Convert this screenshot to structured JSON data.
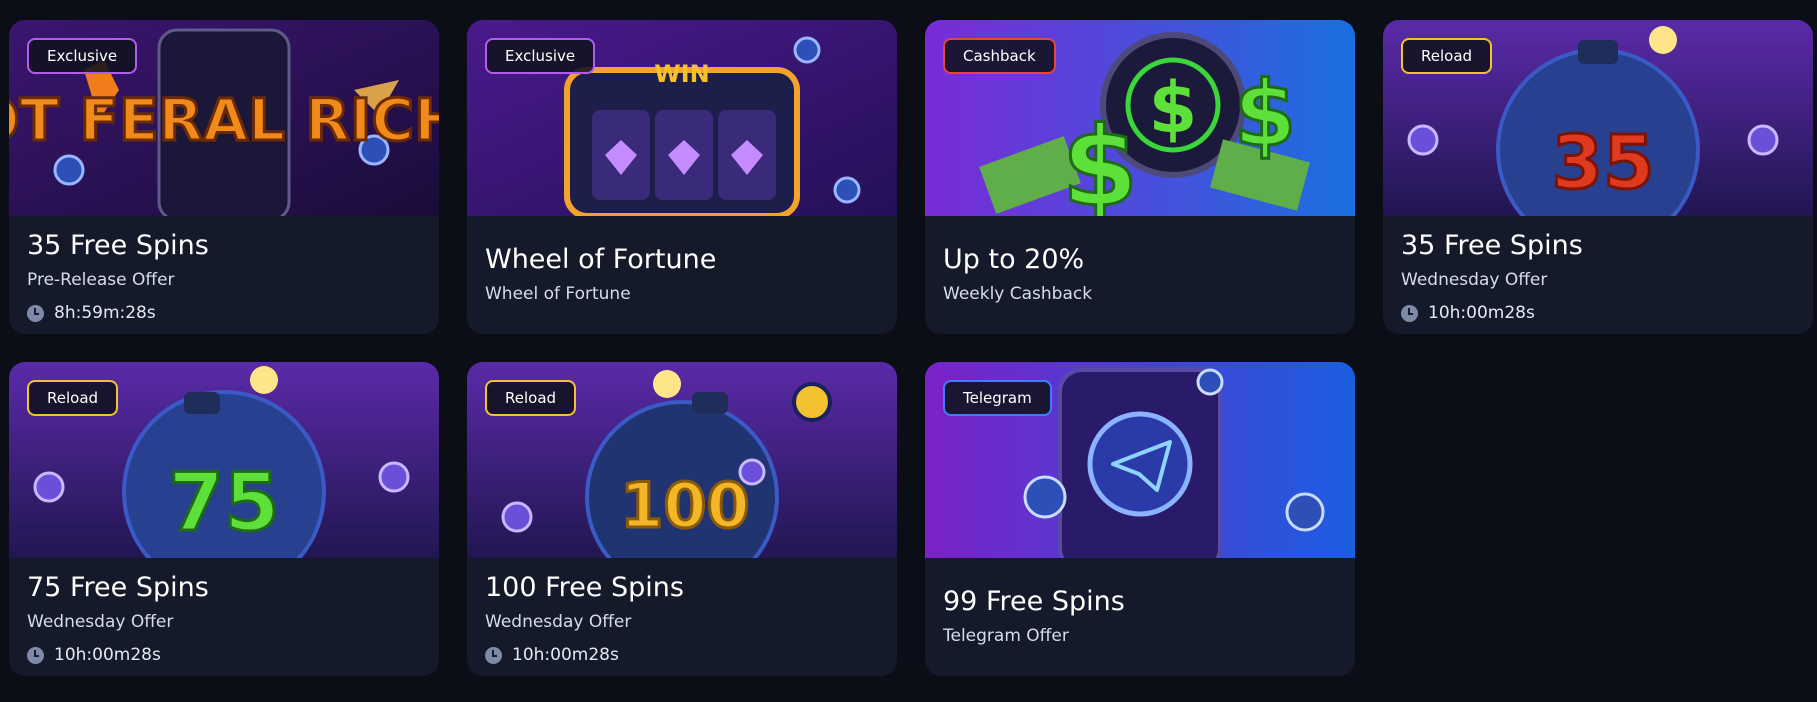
{
  "promotions": [
    {
      "badge": "Exclusive",
      "title": "35 Free Spins",
      "subtitle": "Pre-Release Offer",
      "timer": "8h:59m:28s",
      "banner_text": "RIOT FERAL RICHES"
    },
    {
      "badge": "Exclusive",
      "title": "Wheel of Fortune",
      "subtitle": "Wheel of Fortune",
      "banner_text": "WIN"
    },
    {
      "badge": "Cashback",
      "title": "Up to 20%",
      "subtitle": "Weekly Cashback",
      "banner_text": "$"
    },
    {
      "badge": "Reload",
      "title": "35 Free Spins",
      "subtitle": "Wednesday Offer",
      "timer": "10h:00m28s",
      "banner_text": "35"
    },
    {
      "badge": "Reload",
      "title": "75 Free Spins",
      "subtitle": "Wednesday Offer",
      "timer": "10h:00m28s",
      "banner_text": "75"
    },
    {
      "badge": "Reload",
      "title": "100 Free Spins",
      "subtitle": "Wednesday Offer",
      "timer": "10h:00m28s",
      "banner_text": "100"
    },
    {
      "badge": "Telegram",
      "title": "99 Free Spins",
      "subtitle": "Telegram Offer"
    }
  ],
  "colors": {
    "background": "#0b0e17",
    "card": "#141a29",
    "badge_exclusive": "#b35cf0",
    "badge_cashback": "#e8453c",
    "badge_reload": "#f2c230",
    "badge_telegram": "#3f7dff"
  },
  "icons": {
    "timer": "clock-icon"
  }
}
